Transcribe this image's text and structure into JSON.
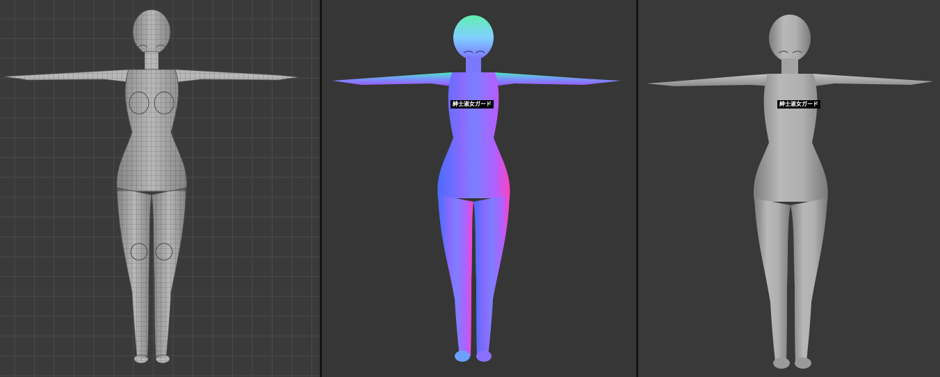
{
  "viewports": [
    {
      "id": "wireframe",
      "shading": "wireframe",
      "grid": true
    },
    {
      "id": "normal",
      "shading": "normal-map"
    },
    {
      "id": "clay",
      "shading": "clay"
    }
  ],
  "censor_bar_text": "紳士淑女ガード",
  "colors": {
    "background_wire": "#3a3a3a",
    "background_dark": "#363636",
    "clay": "#a9a9a9",
    "wire_lines": "#5a5a5a",
    "normal_blue": "#5a7cff",
    "normal_green": "#40e0a0",
    "normal_magenta": "#ff3cc8"
  }
}
